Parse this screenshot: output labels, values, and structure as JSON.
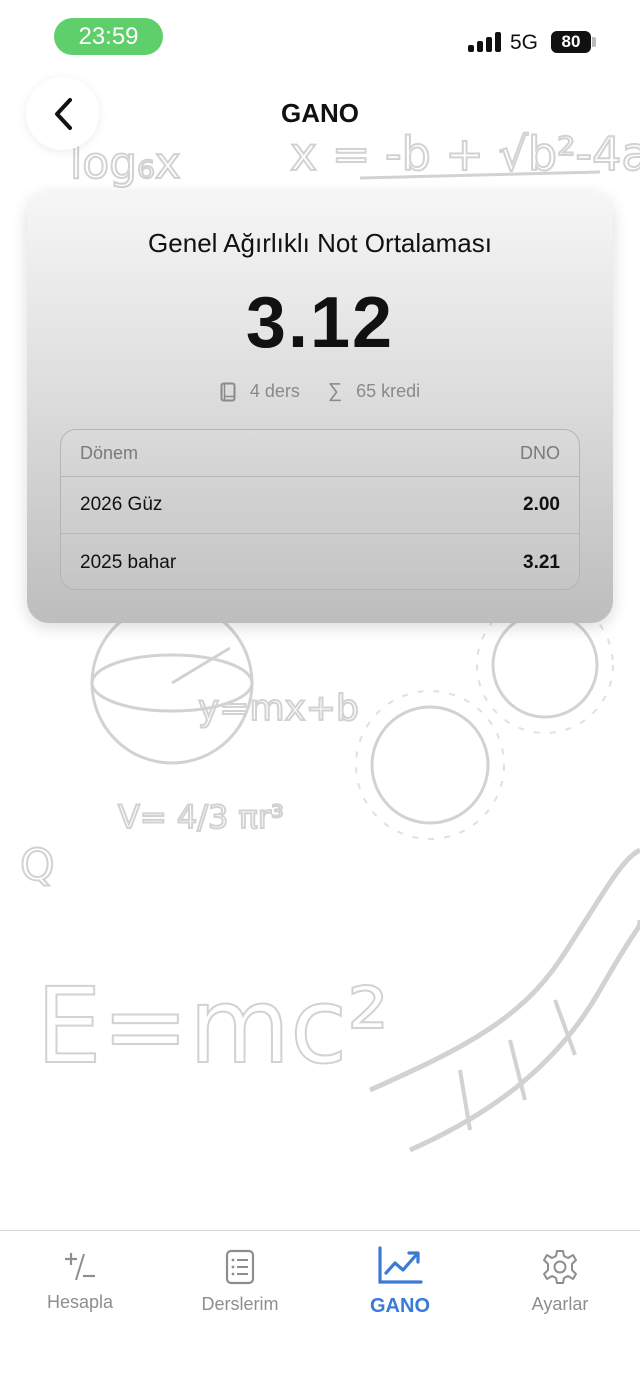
{
  "status_bar": {
    "time": "23:59",
    "network": "5G",
    "battery": "80"
  },
  "header": {
    "title": "GANO",
    "back_icon": "chevron-left-icon"
  },
  "card": {
    "title": "Genel Ağırlıklı Not Ortalaması",
    "gpa": "3.12",
    "course_count": "4 ders",
    "credit_total": "65 kredi",
    "table": {
      "header_term": "Dönem",
      "header_value": "DNO",
      "rows": [
        {
          "term": "2026 Güz",
          "value": "2.00"
        },
        {
          "term": "2025 bahar",
          "value": "3.21"
        }
      ]
    }
  },
  "tabs": [
    {
      "label": "Hesapla",
      "icon": "plus-minus-icon",
      "active": false
    },
    {
      "label": "Derslerim",
      "icon": "document-list-icon",
      "active": false
    },
    {
      "label": "GANO",
      "icon": "chart-line-up-icon",
      "active": true
    },
    {
      "label": "Ayarlar",
      "icon": "gear-icon",
      "active": false
    }
  ],
  "colors": {
    "accent": "#3a7bd5",
    "status_green": "#5ecf6b"
  }
}
